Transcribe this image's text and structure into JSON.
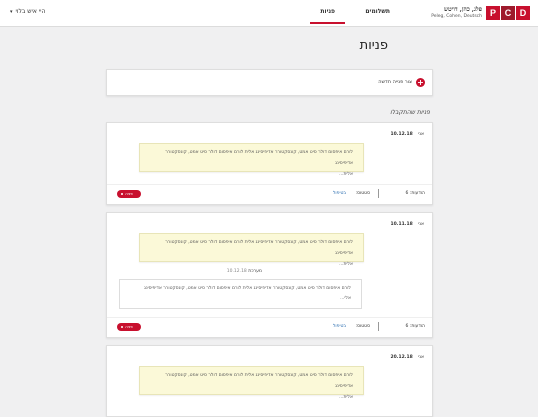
{
  "header": {
    "logo_he": "פלג, כהן, דויטש",
    "logo_en": "Peleg, Cohen, Deutsch",
    "logo_letters": [
      "P",
      "C",
      "D"
    ],
    "tabs": [
      {
        "label": "תשלומים"
      },
      {
        "label": "פניות"
      }
    ],
    "user_menu": "היי איש בלוי",
    "caret": "▾"
  },
  "page_title": "פניות",
  "new_request": {
    "icon": "+",
    "label": "צור פנייה חדשה"
  },
  "section_label": "פניות שהתקבלו",
  "cards": [
    {
      "from": "אני",
      "date": "10.12.18",
      "message_line1": "לורם איפסום דולר סיט אמט, קונסקטורר אדיפיסינג אלית לורם איפסום דולר סיט אמט, קונסקטורר אדיפיסינג",
      "message_line2": "אלית...",
      "attachments": "הודעות: 6",
      "status_label": "סטטוס:",
      "status_value": "בטיפול",
      "chip_label": "פניה"
    },
    {
      "from": "אני",
      "date": "10.11.18",
      "message_line1": "לורם איפסום דולר סיט אמט, קונסקטורר אדיפיסינג אלית לורם איפסום דולר סיט אמט, קונסקטורר אדיפיסינג",
      "message_line2": "אלית...",
      "reply_author": "מערכת",
      "reply_date": "10.12.18",
      "reply_line1": "לורם איפסום דולר סיט אמט, קונסקטורר אדיפיסינג אלית לורם איפסום דולר סיט אמט, קונסקטורר אדיפיסינג",
      "reply_line2": "אלי...",
      "attachments": "הודעות: 6",
      "status_label": "סטטוס:",
      "status_value": "בטיפול",
      "chip_label": "פניה"
    },
    {
      "from": "אני",
      "date": "20.12.18",
      "message_line1": "לורם איפסום דולר סיט אמט, קונסקטורר אדיפיסינג אלית לורם איפסום דולר סיט אמט, קונסקטורר אדיפיסינג",
      "message_line2": "אלית..."
    }
  ]
}
